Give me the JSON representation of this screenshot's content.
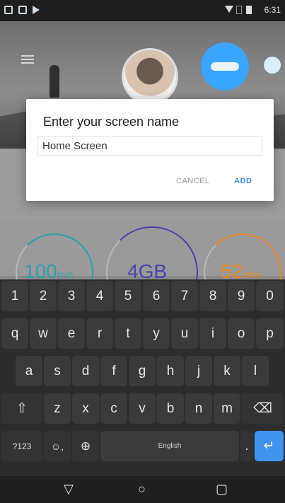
{
  "status": {
    "time": "6:31"
  },
  "dialog": {
    "title": "Enter your screen name",
    "input_value": "Home Screen",
    "cancel_label": "CANCEL",
    "add_label": "ADD",
    "colors": {
      "add": "#3a8ee6",
      "cancel": "#9a9a9a"
    }
  },
  "background_app": {
    "badge_icon": "brand-logo",
    "stats": [
      {
        "value": "100",
        "unit": "min"
      },
      {
        "value": "4GB",
        "unit": ""
      },
      {
        "value": "52",
        "unit": "sms"
      }
    ],
    "colors": {
      "badge": "#3aa5ff",
      "dial_teal": "#2aa0a8",
      "dial_purple": "#4b43a8",
      "dial_orange": "#e58a2a"
    }
  },
  "keyboard": {
    "numbers": [
      "1",
      "2",
      "3",
      "4",
      "5",
      "6",
      "7",
      "8",
      "9",
      "0"
    ],
    "row1": [
      "q",
      "w",
      "e",
      "r",
      "t",
      "y",
      "u",
      "i",
      "o",
      "p"
    ],
    "row2": [
      "a",
      "s",
      "d",
      "f",
      "g",
      "h",
      "j",
      "k",
      "l"
    ],
    "row3": [
      "z",
      "x",
      "c",
      "v",
      "b",
      "n",
      "m"
    ],
    "symbols_label": "?123",
    "space_label": "English",
    "period_label": ".",
    "enter_color": "#3f93ee"
  },
  "navbar": {
    "back_icon": "back-triangle-icon",
    "home_icon": "home-circle-icon",
    "recents_icon": "recents-square-icon"
  }
}
